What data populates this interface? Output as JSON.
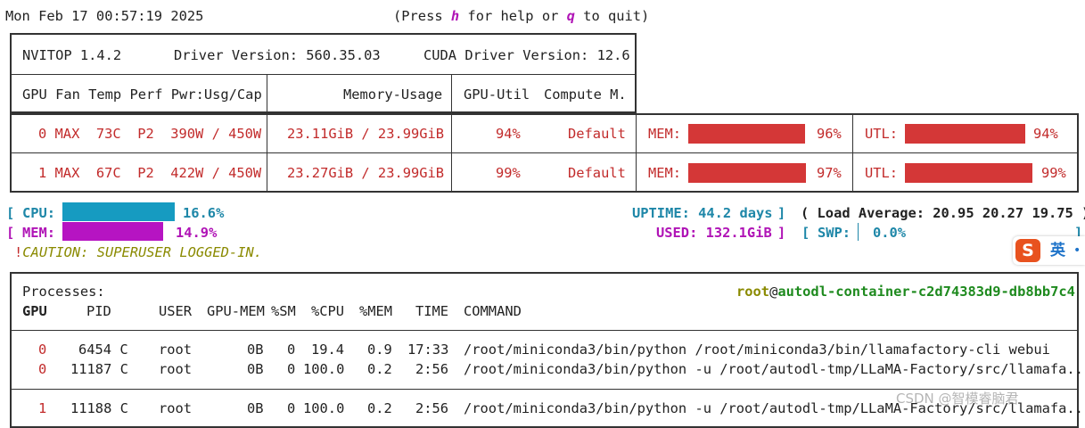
{
  "topbar": {
    "timestamp": "Mon Feb 17 00:57:19 2025",
    "help_prefix": "(Press ",
    "help_key": "h",
    "help_mid": " for help or ",
    "quit_key": "q",
    "help_suffix": " to quit)"
  },
  "header": {
    "app": "NVITOP 1.4.2",
    "driver": "Driver Version: 560.35.03",
    "cuda": "CUDA Driver Version: 12.6",
    "col_gpu": "GPU Fan Temp Perf Pwr:Usg/Cap",
    "col_mem": "Memory-Usage",
    "col_util": "GPU-Util",
    "col_compute": "Compute M."
  },
  "gpus": [
    {
      "info": "0 MAX  73C  P2  390W / 450W",
      "memory": "23.11GiB / 23.99GiB",
      "util": "94%",
      "compute": "Default",
      "mem_label": "MEM:",
      "mem_pct": "96%",
      "mem_frac": 0.96,
      "utl_label": "UTL:",
      "utl_pct": "94%",
      "utl_frac": 0.94
    },
    {
      "info": "1 MAX  67C  P2  422W / 450W",
      "memory": "23.27GiB / 23.99GiB",
      "util": "99%",
      "compute": "Default",
      "mem_label": "MEM:",
      "mem_pct": "97%",
      "mem_frac": 0.97,
      "utl_label": "UTL:",
      "utl_pct": "99%",
      "utl_frac": 0.99
    }
  ],
  "host": {
    "cpu_label": "CPU:",
    "cpu_pct": "16.6%",
    "cpu_frac": 0.166,
    "mem_label": "MEM:",
    "mem_pct": "14.9%",
    "mem_frac": 0.149,
    "uptime": "UPTIME: 44.2 days",
    "used": "USED: 132.1GiB",
    "load": "( Load Average: 20.95 20.27 19.75 )",
    "swp_label": "SWP:",
    "swp_pct": "0.0%",
    "caution_mark": "!",
    "caution": "CAUTION: SUPERUSER LOGGED-IN."
  },
  "processes": {
    "title": "Processes:",
    "user": "root",
    "at": "@",
    "host": "autodl-container-c2d74383d9-db8bb7c4",
    "columns": [
      "GPU",
      "PID",
      "USER",
      "GPU-MEM",
      "%SM",
      "%CPU",
      "%MEM",
      "TIME",
      "COMMAND"
    ],
    "rows": [
      {
        "gpu": "0",
        "pid": "6454 C",
        "user": "root",
        "gpumem": "0B",
        "sm": "0",
        "cpu": "19.4",
        "mem": "0.9",
        "time": "17:33",
        "command": "/root/miniconda3/bin/python /root/miniconda3/bin/llamafactory-cli webui"
      },
      {
        "gpu": "0",
        "pid": "11187 C",
        "user": "root",
        "gpumem": "0B",
        "sm": "0",
        "cpu": "100.0",
        "mem": "0.2",
        "time": "2:56",
        "command": "/root/miniconda3/bin/python -u /root/autodl-tmp/LLaMA-Factory/src/llamafa.."
      },
      {
        "gpu": "1",
        "pid": "11188 C",
        "user": "root",
        "gpumem": "0B",
        "sm": "0",
        "cpu": "100.0",
        "mem": "0.2",
        "time": "2:56",
        "command": "/root/miniconda3/bin/python -u /root/autodl-tmp/LLaMA-Factory/src/llamafa.."
      }
    ]
  },
  "overlay": {
    "ime_logo": "S",
    "ime_lang": "英",
    "ime_dot": "•",
    "watermark": "CSDN @智模睿脑君"
  },
  "colors": {
    "bar_red": "#d43737",
    "cpu_bar": "#169bc1",
    "mem_bar": "#b614c2",
    "text_red": "#c22b2b"
  }
}
